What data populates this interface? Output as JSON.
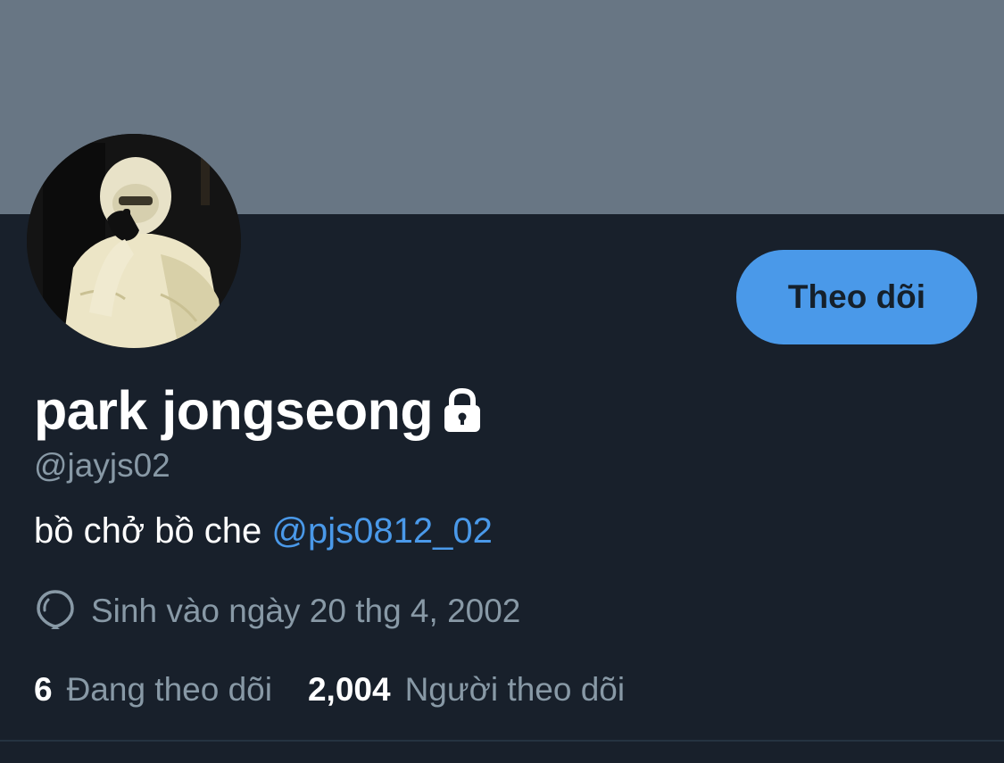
{
  "profile": {
    "display_name": "park jongseong",
    "handle": "@jayjs02",
    "bio_text": "bồ chở bồ che ",
    "bio_mention": "@pjs0812_02",
    "birthday": "Sinh vào ngày 20 thg 4, 2002",
    "protected": true
  },
  "actions": {
    "follow_label": "Theo dõi"
  },
  "stats": {
    "following_count": "6",
    "following_label": "Đang theo dõi",
    "followers_count": "2,004",
    "followers_label": "Người theo dõi"
  },
  "colors": {
    "banner": "#687684",
    "background": "#18202b",
    "accent": "#4a99e9",
    "secondary_text": "#8899a6"
  },
  "icons": {
    "lock": "lock-icon",
    "balloon": "balloon-icon"
  }
}
